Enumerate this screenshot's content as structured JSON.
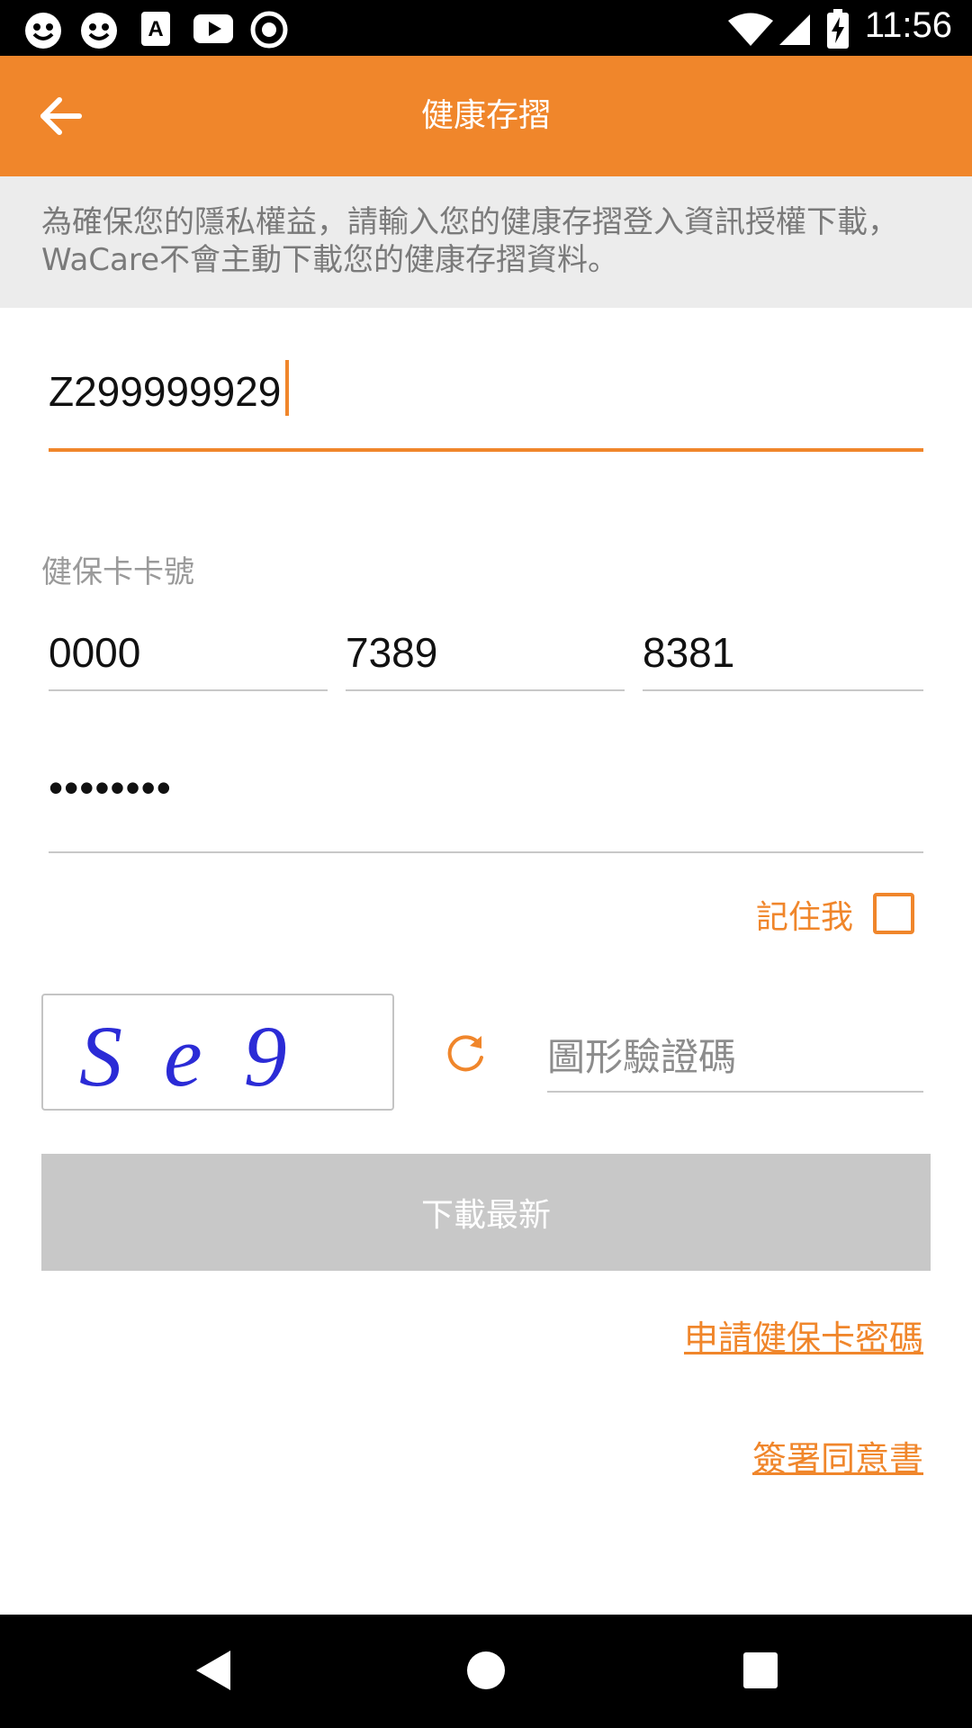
{
  "status_bar": {
    "time": "11:56",
    "icons": [
      "smiley-icon",
      "smiley-icon",
      "font-icon",
      "youtube-icon",
      "record-icon",
      "wifi-icon",
      "signal-icon",
      "battery-charging-icon"
    ]
  },
  "app_bar": {
    "title": "健康存摺",
    "back_icon": "arrow-left-icon"
  },
  "info": {
    "text": "為確保您的隱私權益，請輸入您的健康存摺登入資訊授權下載，WaCare不會主動下載您的健康存摺資料。"
  },
  "form": {
    "id_value": "Z299999929",
    "card_label": "健保卡卡號",
    "card_parts": [
      "0000",
      "7389",
      "8381"
    ],
    "password_value": "••••••••",
    "remember_label": "記住我",
    "captcha_text": "Se9",
    "captcha_placeholder": "圖形驗證碼",
    "download_label": "下載最新"
  },
  "links": {
    "apply_card_password": "申請健保卡密碼",
    "sign_consent": "簽署同意書"
  },
  "colors": {
    "accent": "#f0862b",
    "banner_bg": "#ececec",
    "disabled_button": "#c8c8c8"
  }
}
